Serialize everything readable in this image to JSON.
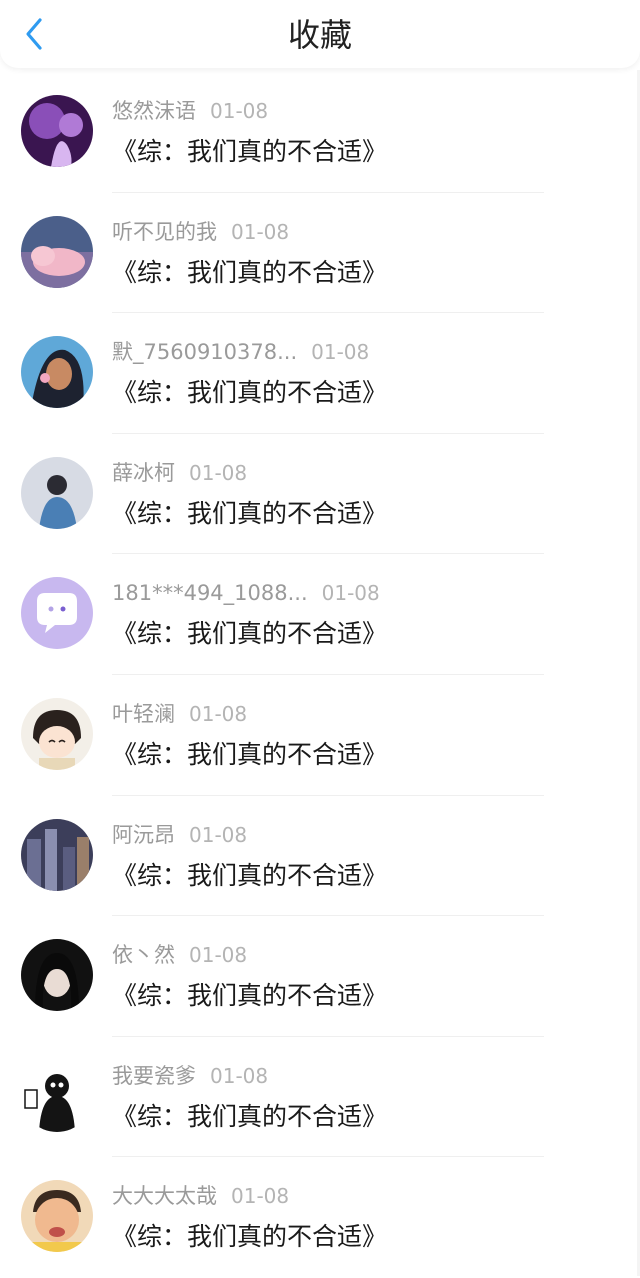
{
  "header": {
    "title": "收藏",
    "back_icon": "chevron-left-icon",
    "accent_color": "#2f9bf0"
  },
  "items": [
    {
      "name": "悠然沫语",
      "date": "01-08",
      "title": "《综：我们真的不合适》"
    },
    {
      "name": "听不见的我",
      "date": "01-08",
      "title": "《综：我们真的不合适》"
    },
    {
      "name": "默_7560910378...",
      "date": "01-08",
      "title": "《综：我们真的不合适》"
    },
    {
      "name": "薛冰柯",
      "date": "01-08",
      "title": "《综：我们真的不合适》"
    },
    {
      "name": "181***494_1088...",
      "date": "01-08",
      "title": "《综：我们真的不合适》"
    },
    {
      "name": "叶轻澜",
      "date": "01-08",
      "title": "《综：我们真的不合适》"
    },
    {
      "name": "阿沅昂",
      "date": "01-08",
      "title": "《综：我们真的不合适》"
    },
    {
      "name": "依丶然",
      "date": "01-08",
      "title": "《综：我们真的不合适》"
    },
    {
      "name": "我要瓷爹",
      "date": "01-08",
      "title": "《综：我们真的不合适》"
    },
    {
      "name": "大大大太哉",
      "date": "01-08",
      "title": "《综：我们真的不合适》"
    }
  ]
}
